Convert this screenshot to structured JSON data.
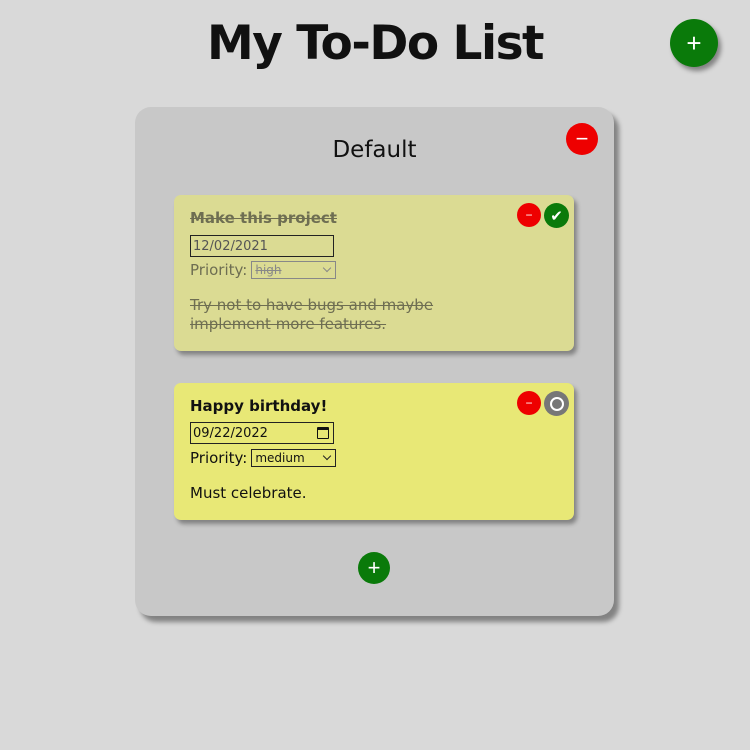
{
  "header": {
    "title": "My To-Do List",
    "add_project_icon": "+"
  },
  "colors": {
    "background": "#d9d9d9",
    "add_green": "#0a7a0a",
    "delete_red": "#ee0000",
    "todo_done_bg": "#dbdb93",
    "todo_active_bg": "#e8e876"
  },
  "project": {
    "title": "Default",
    "delete_icon": "−",
    "add_todo_icon": "+",
    "todos": [
      {
        "title": "Make this project",
        "date": "12/02/2021",
        "priority_label": "Priority:",
        "priority": "high",
        "description": "Try not to have bugs and maybe implement more features.",
        "completed": true,
        "delete_icon": "−",
        "status_icon": "✔"
      },
      {
        "title": "Happy birthday!",
        "date": "09/22/2022",
        "priority_label": "Priority:",
        "priority": "medium",
        "description": "Must celebrate.",
        "completed": false,
        "delete_icon": "−",
        "status_icon": "ring-icon"
      }
    ]
  }
}
